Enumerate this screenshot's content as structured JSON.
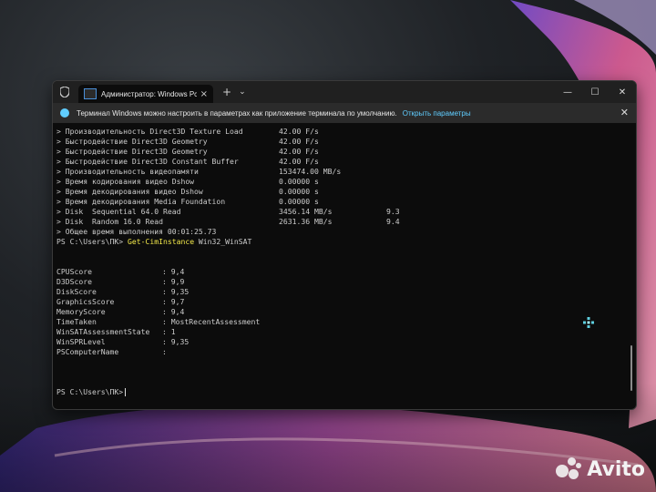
{
  "tab": {
    "title": "Администратор: Windows Pc",
    "new_tab": "+",
    "dropdown": "⌄",
    "close": "×"
  },
  "window_controls": {
    "minimize": "—",
    "maximize": "☐",
    "close": "✕"
  },
  "infobar": {
    "text": "Терминал Windows можно настроить в параметрах как приложение терминала по умолчанию.",
    "link": "Открыть параметры",
    "close": "✕"
  },
  "console": {
    "winsat_lines": [
      {
        "name": "> Производительность Direct3D Texture Load",
        "value": "42.00 F/s",
        "score": ""
      },
      {
        "name": "> Быстродействие Direct3D Geometry",
        "value": "42.00 F/s",
        "score": ""
      },
      {
        "name": "> Быстродействие Direct3D Geometry",
        "value": "42.00 F/s",
        "score": ""
      },
      {
        "name": "> Быстродействие Direct3D Constant Buffer",
        "value": "42.00 F/s",
        "score": ""
      },
      {
        "name": "> Производительность видеопамяти",
        "value": "153474.00 MB/s",
        "score": ""
      },
      {
        "name": "> Время кодирования видео Dshow",
        "value": "0.00000 s",
        "score": ""
      },
      {
        "name": "> Время декодирования видео Dshow",
        "value": "0.00000 s",
        "score": ""
      },
      {
        "name": "> Время декодирования Media Foundation",
        "value": "0.00000 s",
        "score": ""
      },
      {
        "name": "> Disk  Sequential 64.0 Read",
        "value": "3456.14 MB/s",
        "score": "9.3"
      },
      {
        "name": "> Disk  Random 16.0 Read",
        "value": "2631.36 MB/s",
        "score": "9.4"
      }
    ],
    "total_time": "> Общее время выполнения 00:01:25.73",
    "prompt1": "PS C:\\Users\\ПК> ",
    "command": "Get-CimInstance",
    "command_arg": " Win32_WinSAT",
    "properties": [
      {
        "name": "CPUScore",
        "value": ": 9,4"
      },
      {
        "name": "D3DScore",
        "value": ": 9,9"
      },
      {
        "name": "DiskScore",
        "value": ": 9,35"
      },
      {
        "name": "GraphicsScore",
        "value": ": 9,7"
      },
      {
        "name": "MemoryScore",
        "value": ": 9,4"
      },
      {
        "name": "TimeTaken",
        "value": ": MostRecentAssessment"
      },
      {
        "name": "WinSATAssessmentState",
        "value": ": 1"
      },
      {
        "name": "WinSPRLevel",
        "value": ": 9,35"
      },
      {
        "name": "PSComputerName",
        "value": ":"
      }
    ],
    "prompt2": "PS C:\\Users\\ПК>"
  },
  "watermark": {
    "brand": "Avito"
  },
  "colors": {
    "accent": "#60cdff",
    "command": "#f2e84a",
    "console_bg": "#0c0c0c",
    "console_text": "#cccccc"
  }
}
